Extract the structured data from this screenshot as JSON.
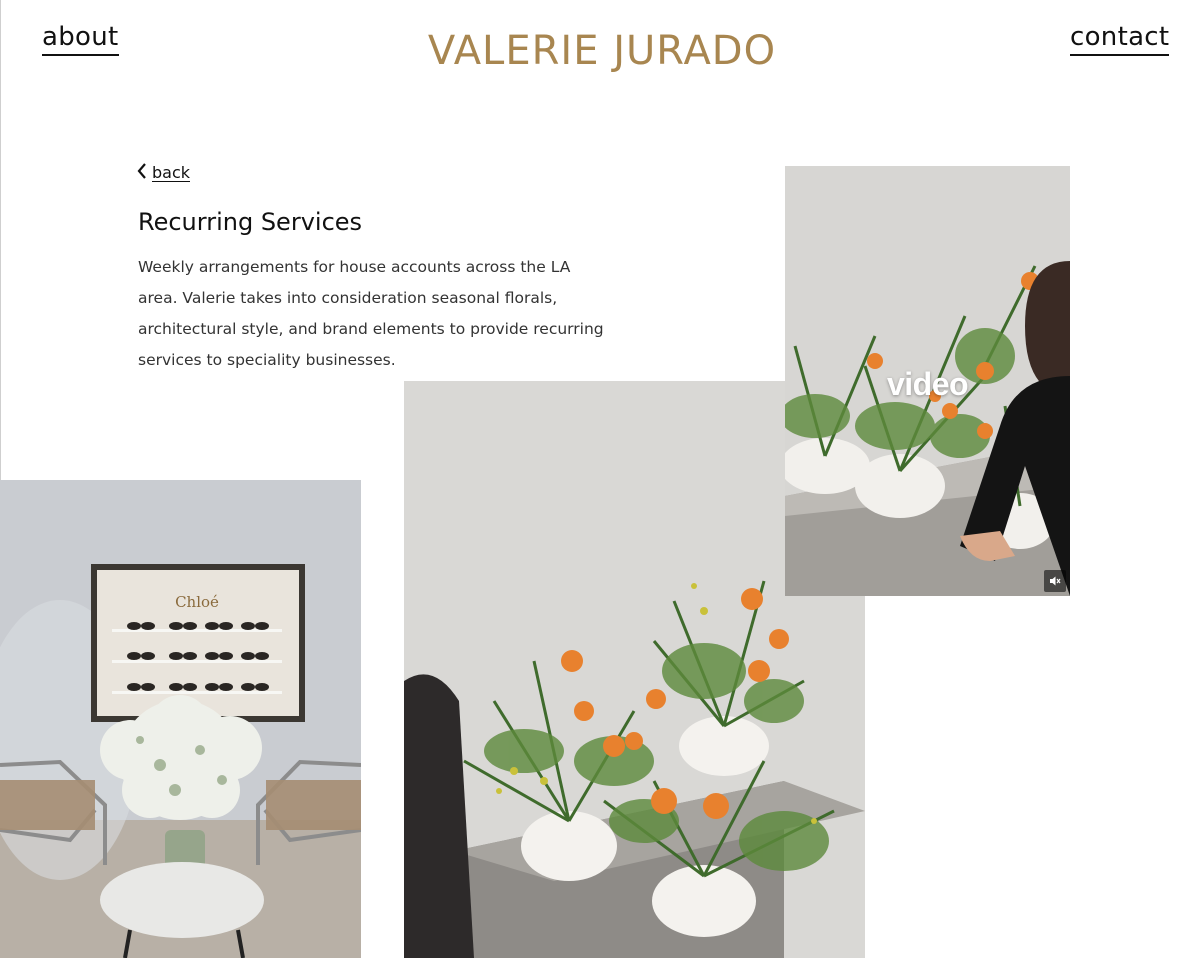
{
  "nav": {
    "about_label": "about",
    "contact_label": "contact"
  },
  "brand": {
    "logo_text": "VALERIE JURADO",
    "logo_color": "#a88650"
  },
  "project": {
    "back_label": "back",
    "title": "Recurring Services",
    "description": "Weekly arrangements for house accounts across the LA area. Valerie takes into consideration seasonal florals, architectural style, and brand elements to provide recurring services to speciality businesses."
  },
  "media": {
    "video_label": "video",
    "store_sign": "Chloé",
    "mute_icon": "mute-icon",
    "back_icon": "chevron-left-icon"
  }
}
